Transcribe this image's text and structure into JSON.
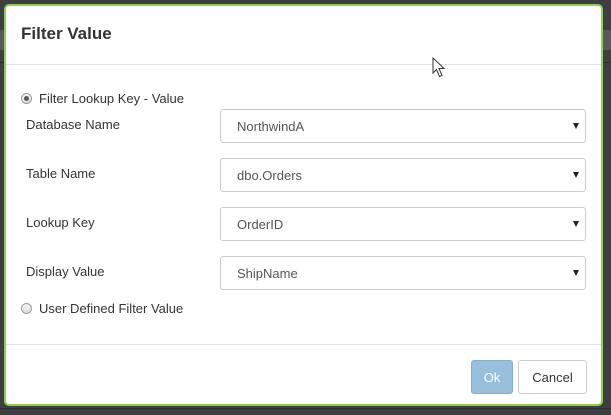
{
  "dialog": {
    "title": "Filter Value"
  },
  "options": {
    "lookup": {
      "label": "Filter Lookup Key - Value",
      "checked": true
    },
    "user_defined": {
      "label": "User Defined Filter Value",
      "checked": false
    }
  },
  "fields": {
    "database": {
      "label": "Database Name",
      "value": "NorthwindA"
    },
    "table": {
      "label": "Table Name",
      "value": "dbo.Orders"
    },
    "lookup_key": {
      "label": "Lookup Key",
      "value": "OrderID"
    },
    "display_value": {
      "label": "Display Value",
      "value": "ShipName"
    }
  },
  "footer": {
    "ok_label": "Ok",
    "cancel_label": "Cancel"
  },
  "colors": {
    "dialog_border": "#8fcf4f",
    "ok_button": "#99bfde"
  },
  "icons": {
    "cursor": "mouse-pointer-icon",
    "dropdown": "chevron-down-icon"
  }
}
